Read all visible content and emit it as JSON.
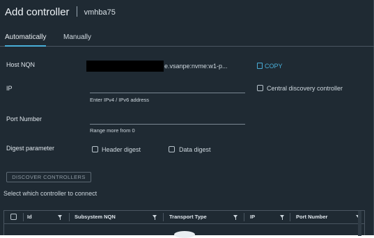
{
  "dialog": {
    "title": "Add controller",
    "subtitle": "vmhba75"
  },
  "tabs": [
    {
      "label": "Automatically",
      "active": true
    },
    {
      "label": "Manually",
      "active": false
    }
  ],
  "form": {
    "host_nqn": {
      "label": "Host NQN",
      "value": "e.vsanpe:nvme:w1-p...",
      "copy_label": "COPY"
    },
    "ip": {
      "label": "IP",
      "helper": "Enter IPv4 / IPv6 address",
      "value": ""
    },
    "central_discovery": {
      "label": "Central discovery controller",
      "checked": false
    },
    "port": {
      "label": "Port Number",
      "helper": "Range more from 0",
      "value": ""
    },
    "digest": {
      "label": "Digest parameter",
      "header_label": "Header digest",
      "header_checked": false,
      "data_label": "Data digest",
      "data_checked": false
    }
  },
  "discover_button": "DISCOVER CONTROLLERS",
  "select_text": "Select which controller to connect",
  "table": {
    "columns": [
      "Id",
      "Subsystem NQN",
      "Transport Type",
      "IP",
      "Port Number"
    ]
  },
  "colors": {
    "background": "#1f2a33",
    "accent": "#49afd9"
  }
}
